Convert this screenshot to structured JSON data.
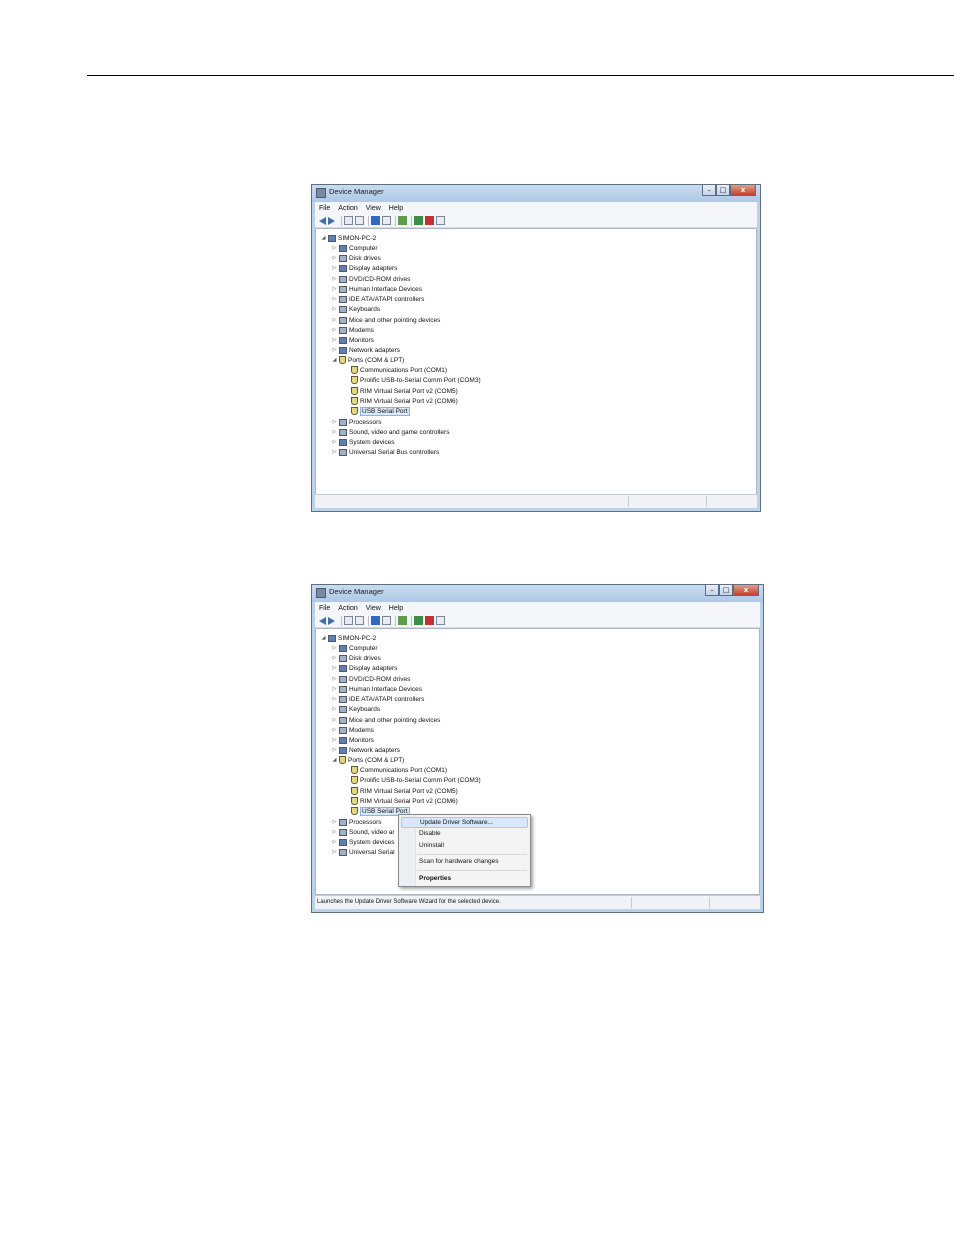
{
  "window_title": "Device Manager",
  "window_buttons": [
    "–",
    "□",
    "x"
  ],
  "menus": [
    "File",
    "Action",
    "View",
    "Help"
  ],
  "tree": {
    "root": "SIMON-PC-2",
    "categories": [
      "Computer",
      "Disk drives",
      "Display adapters",
      "DVD/CD-ROM drives",
      "Human Interface Devices",
      "IDE ATA/ATAPI controllers",
      "Keyboards",
      "Mice and other pointing devices",
      "Modems",
      "Monitors",
      "Network adapters",
      "Ports (COM & LPT)"
    ],
    "ports": [
      "Communications Port (COM1)",
      "Prolific USB-to-Serial Comm Port (COM3)",
      "RIM Virtual Serial Port v2 (COM5)",
      "RIM Virtual Serial Port v2 (COM6)",
      "USB Serial Port"
    ],
    "after": [
      "Processors",
      "Sound, video and game controllers",
      "System devices",
      "Universal Serial Bus controllers"
    ]
  },
  "window2_truncated": {
    "usb": "USB Serial Port",
    "sound": "Sound, video ar",
    "system": "System devices",
    "usbc": "Universal Serial"
  },
  "context_menu": {
    "update": "Update Driver Software...",
    "disable": "Disable",
    "uninstall": "Uninstall",
    "scan": "Scan for hardware changes",
    "properties": "Properties"
  },
  "status_text": "Launches the Update Driver Software Wizard for the selected device."
}
